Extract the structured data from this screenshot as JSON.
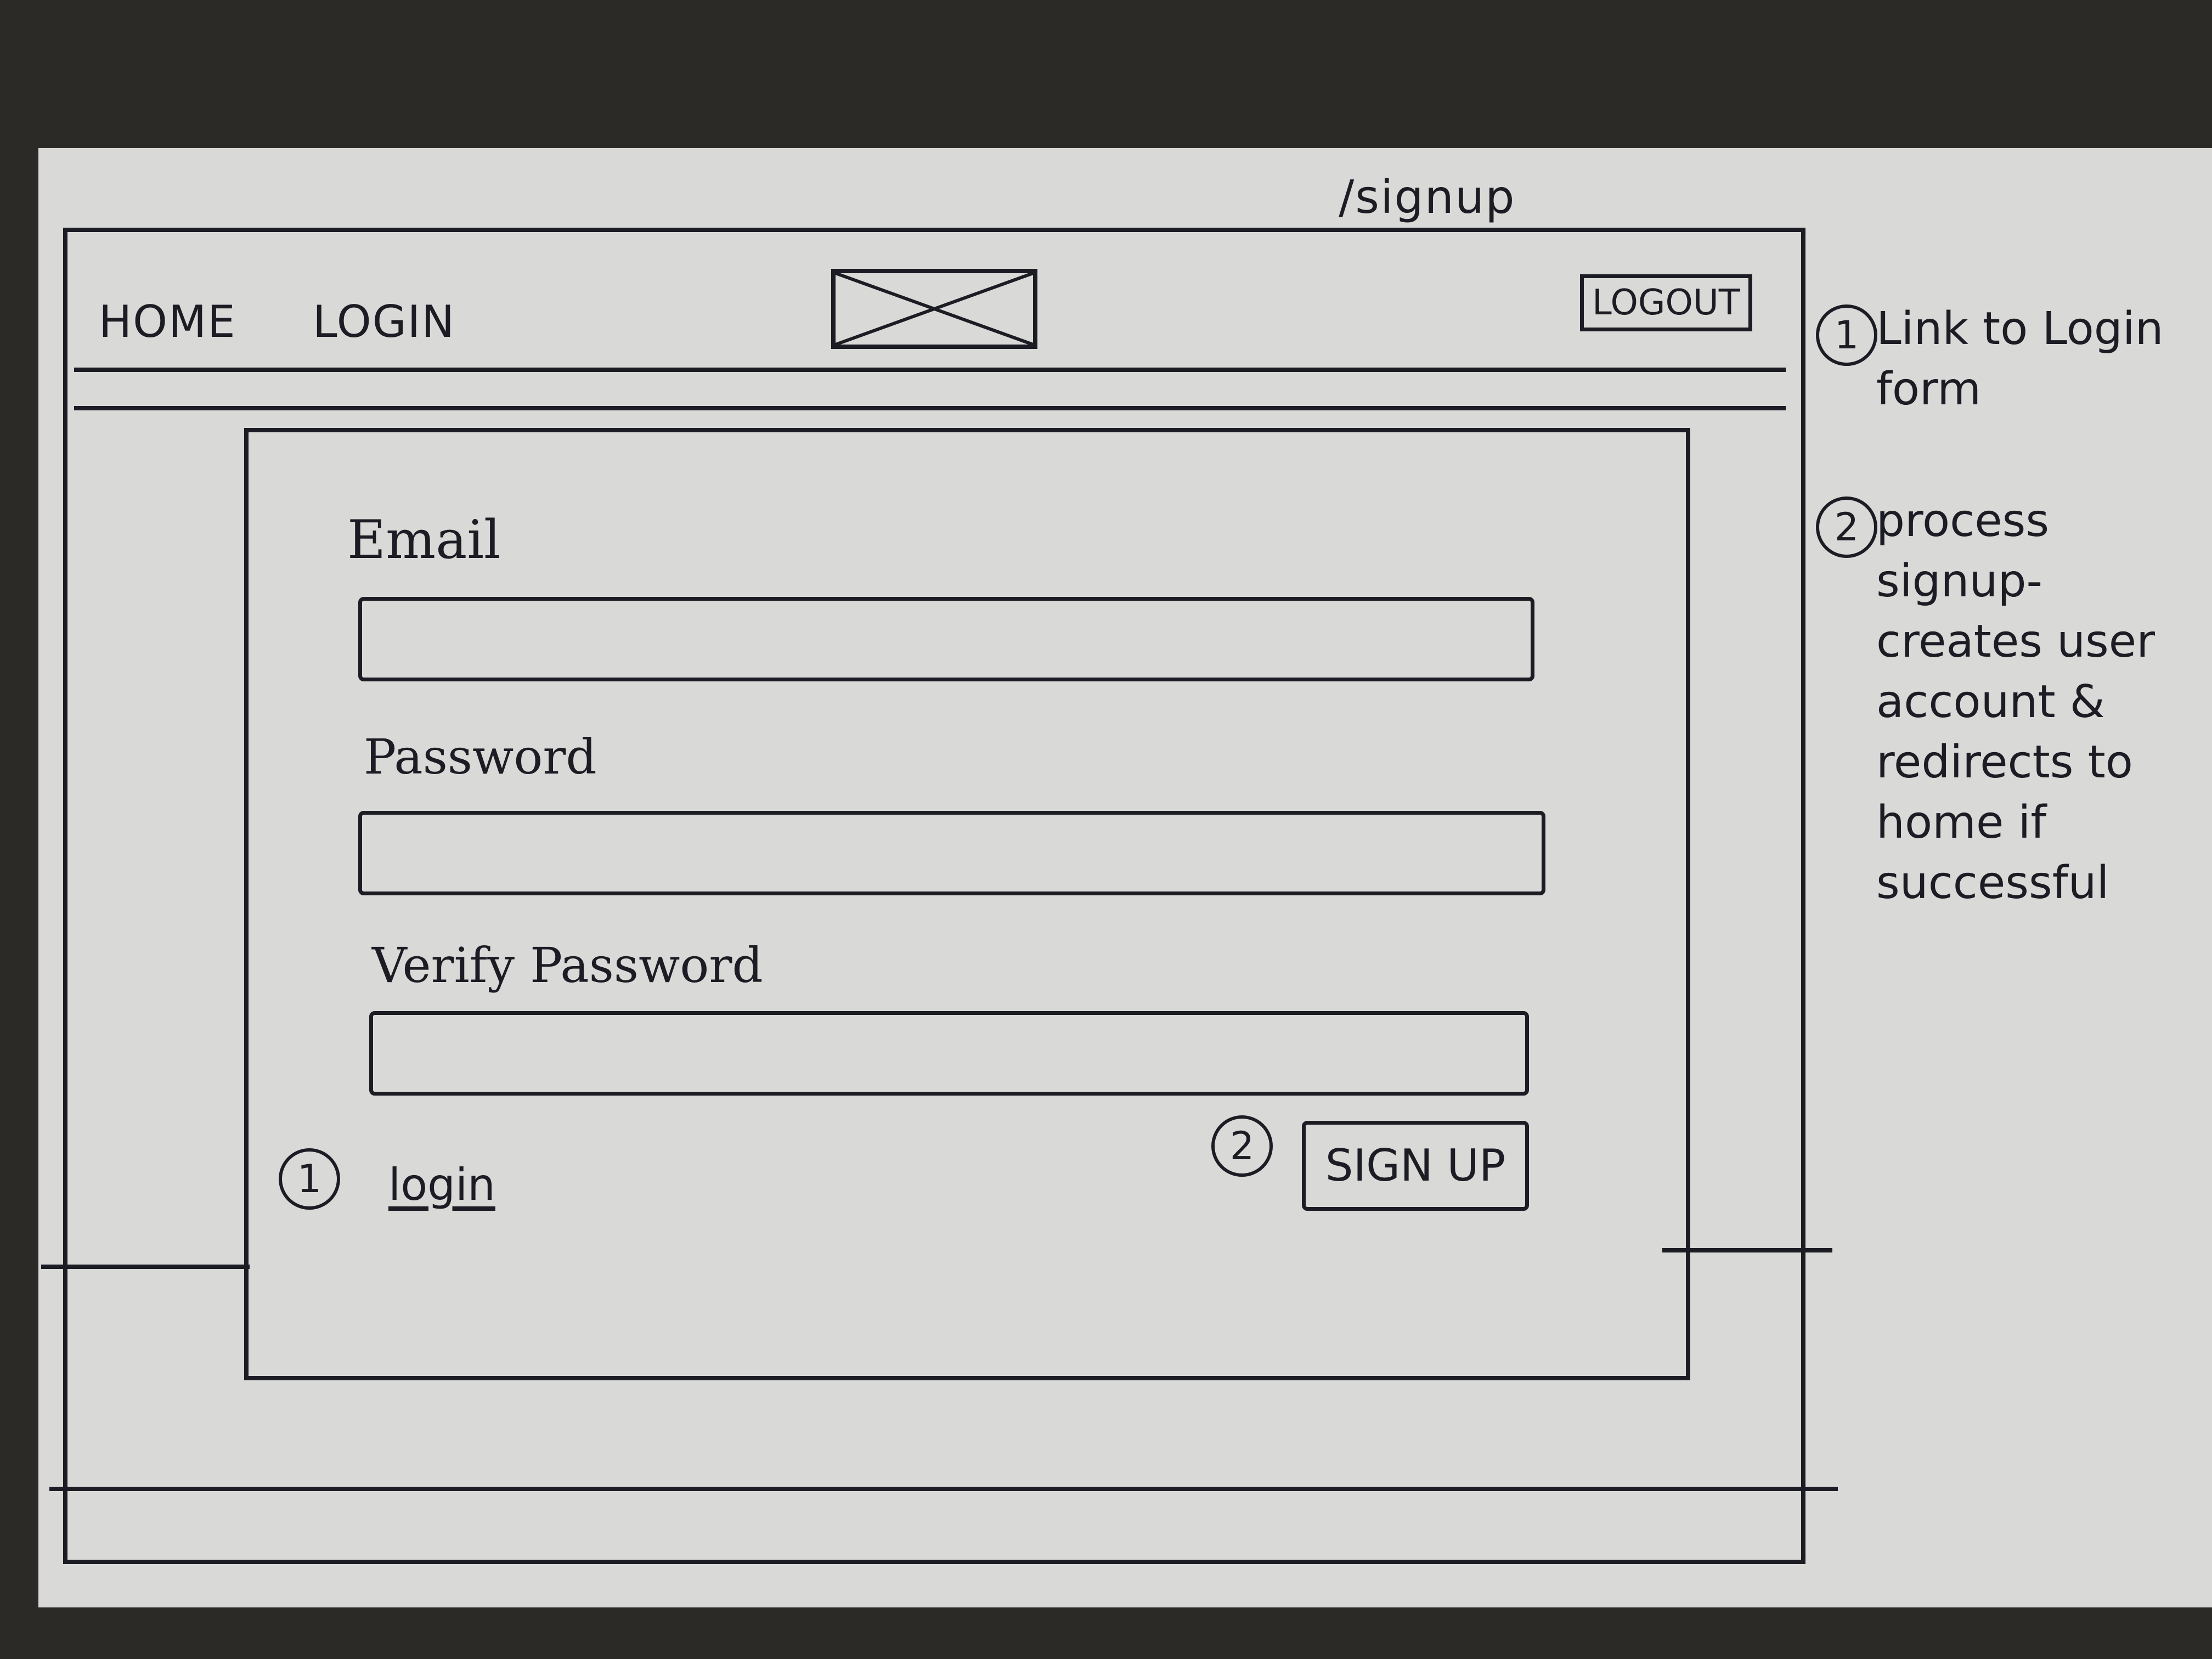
{
  "route": "/signup",
  "nav": {
    "home_label": "HOME",
    "login_label": "LOGIN",
    "logout_label": "LOGOUT"
  },
  "form": {
    "email_label": "Email",
    "password_label": "Password",
    "verify_label": "Verify Password",
    "login_link": "login",
    "signup_button": "SIGN UP",
    "login_marker": "1",
    "signup_marker": "2"
  },
  "notes": [
    {
      "marker": "1",
      "text": "Link to Login form"
    },
    {
      "marker": "2",
      "text": "process signup-creates user account & redirects to home if successful"
    }
  ]
}
